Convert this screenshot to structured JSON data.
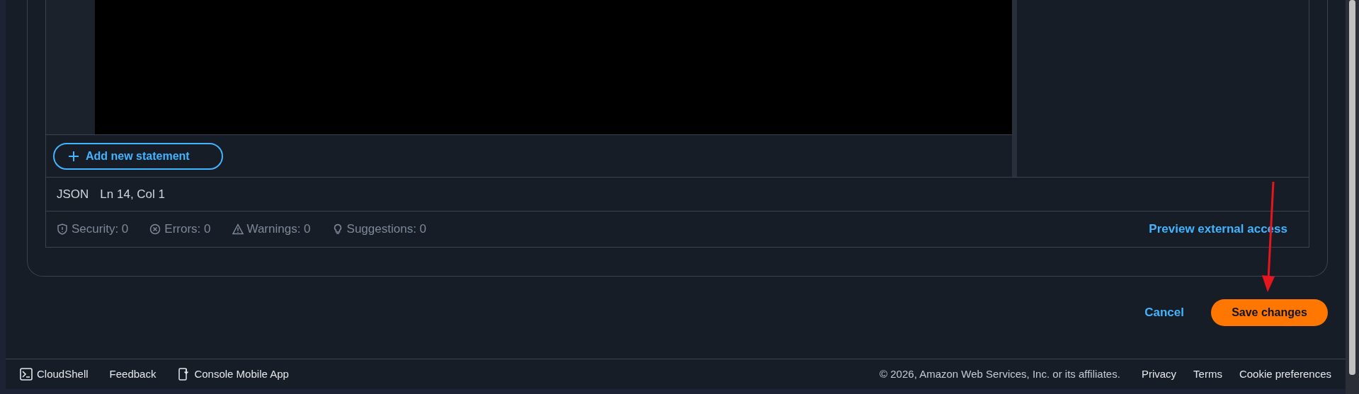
{
  "editor": {
    "add_button": "Add new statement",
    "status": {
      "mode": "JSON",
      "position": "Ln 14, Col 1"
    }
  },
  "issues": [
    {
      "kind": "security",
      "label": "Security: 0"
    },
    {
      "kind": "errors",
      "label": "Errors: 0"
    },
    {
      "kind": "warnings",
      "label": "Warnings: 0"
    },
    {
      "kind": "suggestions",
      "label": "Suggestions: 0"
    }
  ],
  "preview_link": "Preview external access",
  "actions": {
    "cancel": "Cancel",
    "save": "Save changes"
  },
  "footer": {
    "left": [
      {
        "kind": "cloudshell",
        "label": "CloudShell"
      },
      {
        "kind": "plain",
        "label": "Feedback"
      },
      {
        "kind": "mobile",
        "label": "Console Mobile App"
      }
    ],
    "copyright": "© 2026, Amazon Web Services, Inc. or its affiliates.",
    "links": [
      "Privacy",
      "Terms",
      "Cookie preferences"
    ]
  }
}
